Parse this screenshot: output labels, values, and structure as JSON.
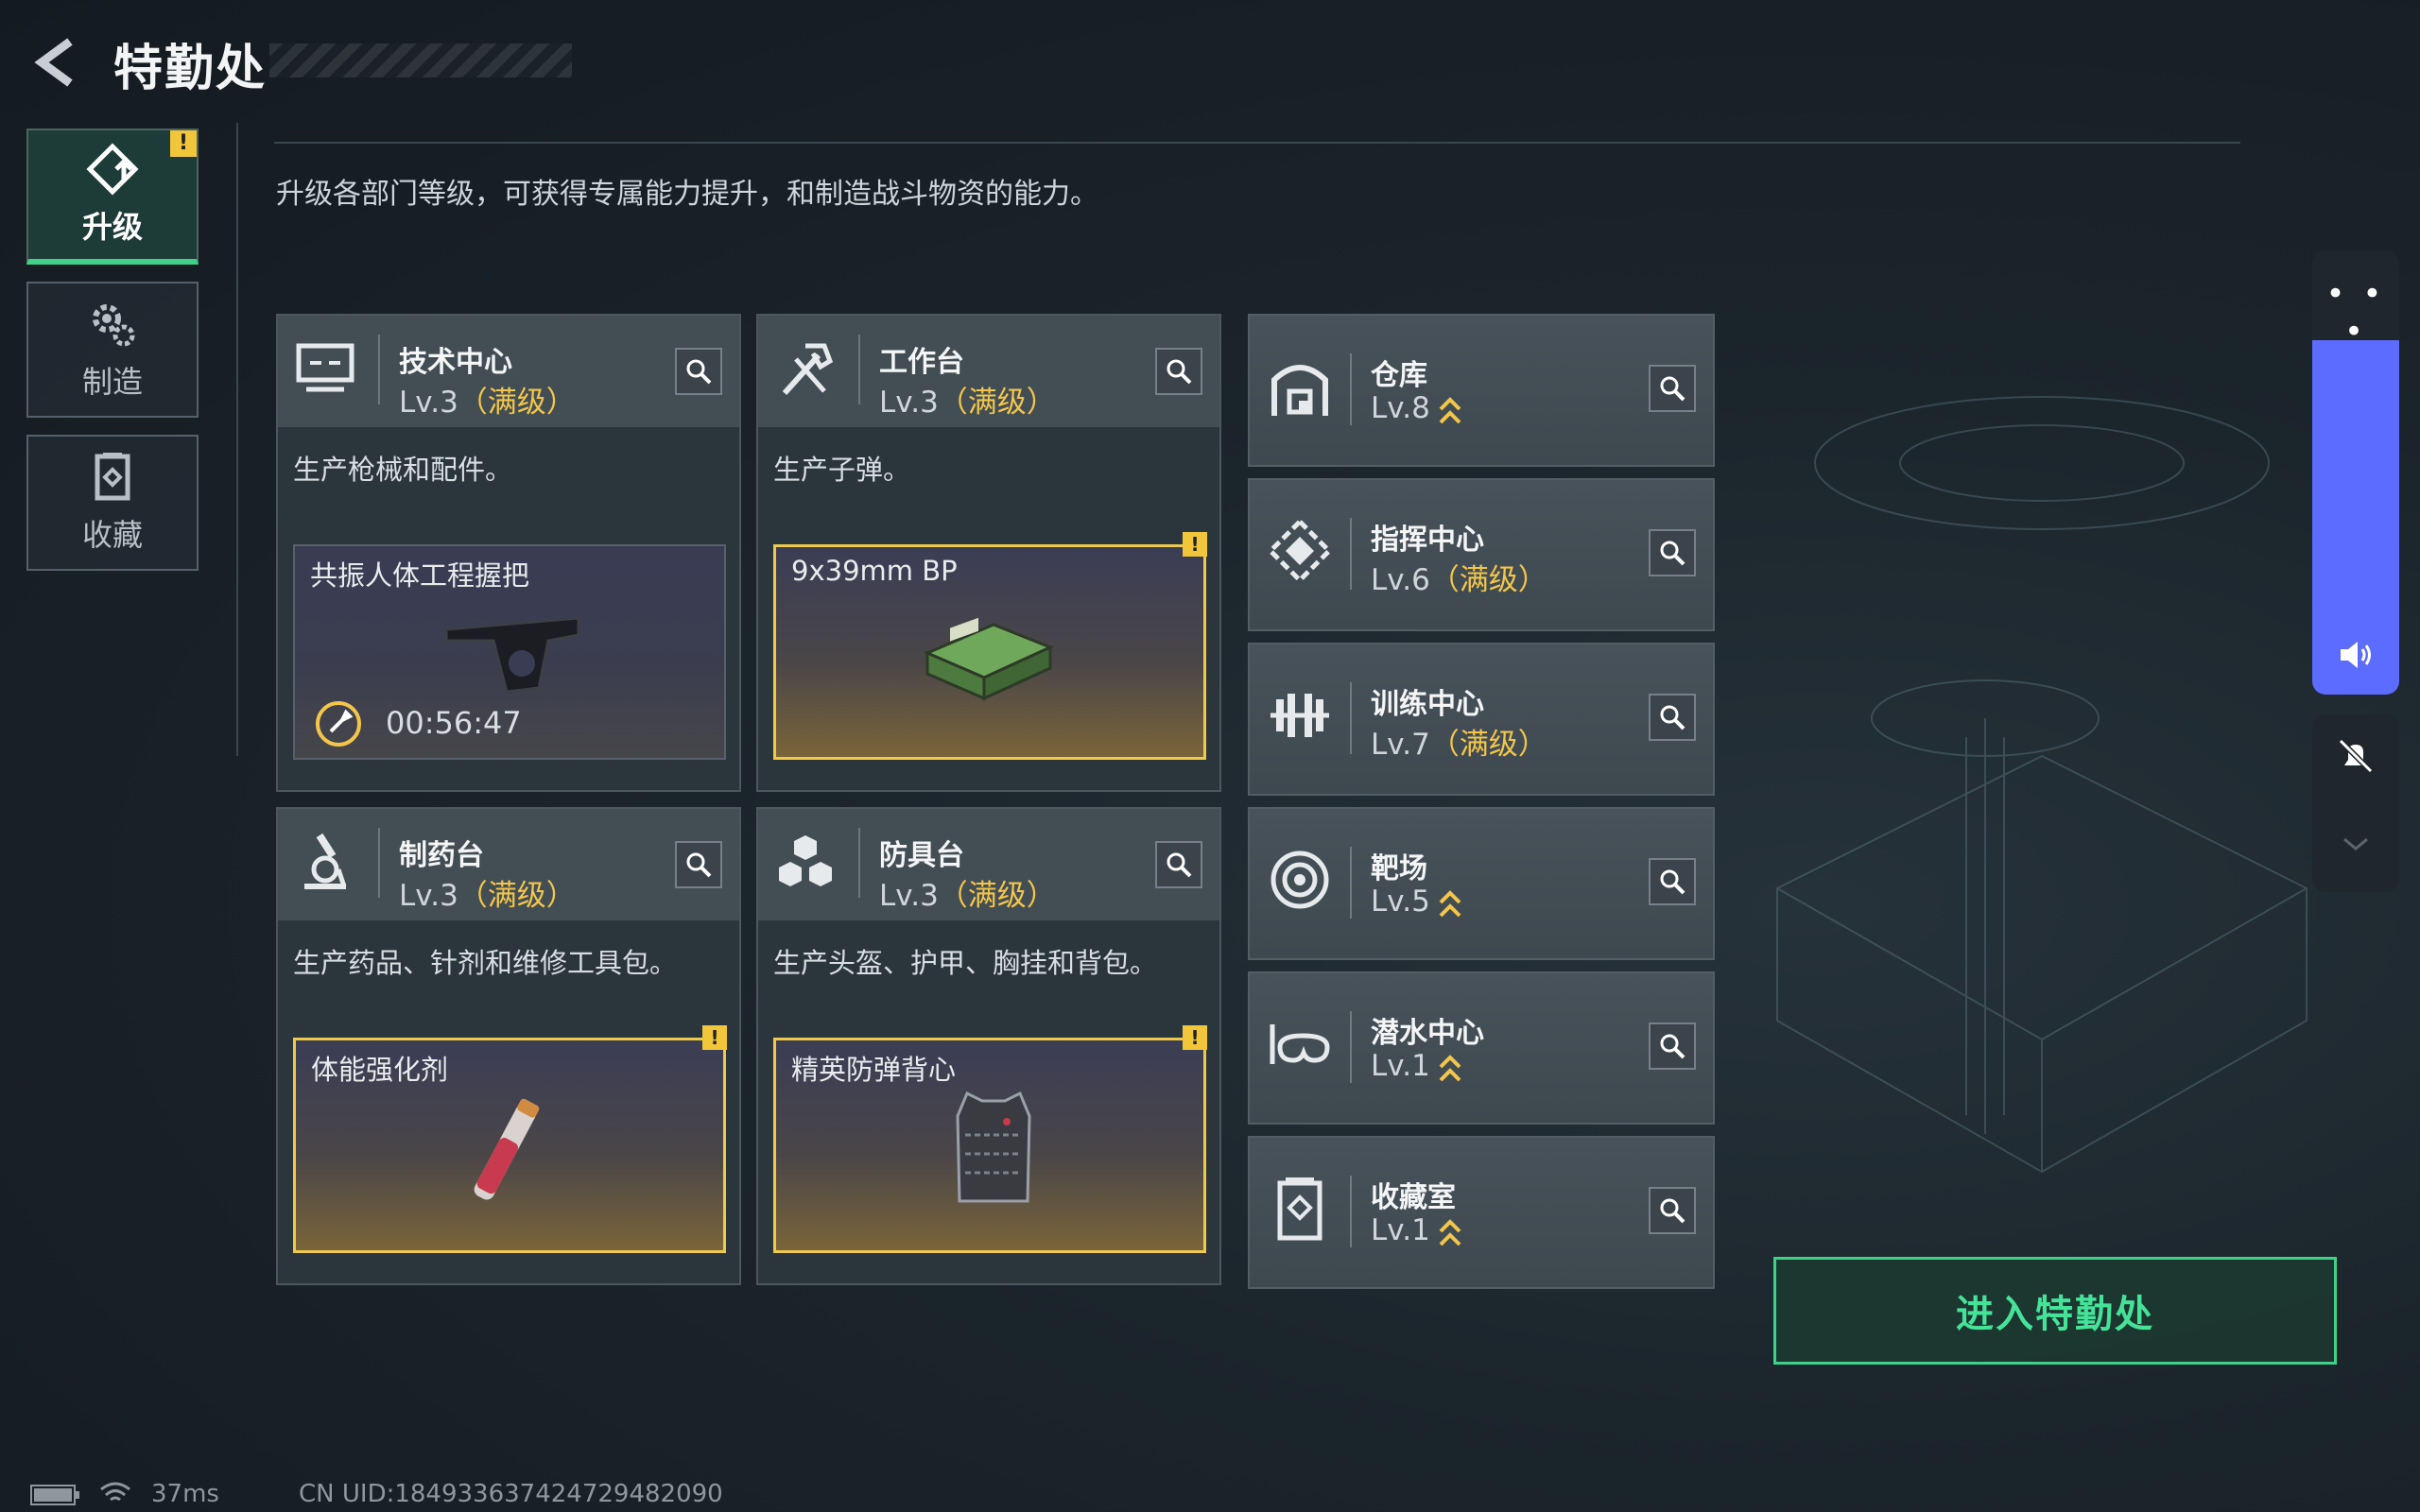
{
  "header": {
    "title": "特勤处",
    "back_icon": "back-arrow-icon"
  },
  "nav": [
    {
      "label": "升级",
      "icon": "upgrade-icon",
      "active": true,
      "alert": "!"
    },
    {
      "label": "制造",
      "icon": "gear-icon",
      "active": false
    },
    {
      "label": "收藏",
      "icon": "collection-icon",
      "active": false
    }
  ],
  "description": "升级各部门等级，可获得专属能力提升，和制造战斗物资的能力。",
  "workshops": [
    {
      "name": "技术中心",
      "level": "Lv.3",
      "max_tag": "（满级）",
      "icon": "computer-icon",
      "desc": "生产枪械和配件。",
      "craft": {
        "name": "共振人体工程握把",
        "timer": "00:56:47",
        "complete": false
      }
    },
    {
      "name": "工作台",
      "level": "Lv.3",
      "max_tag": "（满级）",
      "icon": "hammer-icon",
      "desc": "生产子弹。",
      "craft": {
        "name": "9x39mm BP",
        "complete": true,
        "alert": "!"
      }
    },
    {
      "name": "制药台",
      "level": "Lv.3",
      "max_tag": "（满级）",
      "icon": "microscope-icon",
      "desc": "生产药品、针剂和维修工具包。",
      "craft": {
        "name": "体能强化剂",
        "complete": true,
        "alert": "!"
      }
    },
    {
      "name": "防具台",
      "level": "Lv.3",
      "max_tag": "（满级）",
      "icon": "cubes-icon",
      "desc": "生产头盔、护甲、胸挂和背包。",
      "craft": {
        "name": "精英防弹背心",
        "complete": true,
        "alert": "!"
      }
    }
  ],
  "facilities": [
    {
      "name": "仓库",
      "level": "Lv.8",
      "max_tag": "",
      "upgradable": true,
      "icon": "warehouse-icon"
    },
    {
      "name": "指挥中心",
      "level": "Lv.6",
      "max_tag": "（满级）",
      "upgradable": false,
      "icon": "command-icon"
    },
    {
      "name": "训练中心",
      "level": "Lv.7",
      "max_tag": "（满级）",
      "upgradable": false,
      "icon": "dumbbell-icon"
    },
    {
      "name": "靶场",
      "level": "Lv.5",
      "max_tag": "",
      "upgradable": true,
      "icon": "target-icon"
    },
    {
      "name": "潜水中心",
      "level": "Lv.1",
      "max_tag": "",
      "upgradable": true,
      "icon": "diving-mask-icon"
    },
    {
      "name": "收藏室",
      "level": "Lv.1",
      "max_tag": "",
      "upgradable": true,
      "icon": "collection-room-icon"
    }
  ],
  "enter_button": "进入特勤处",
  "side_control": {
    "dots": "• • •",
    "volume_icon": "speaker-icon",
    "mute_icon": "bell-off-icon"
  },
  "status_bar": {
    "ping": "37ms",
    "uid": "CN UID:184933637424729482090"
  },
  "colors": {
    "accent_green": "#3fd18a",
    "gold": "#f1c64b",
    "volume_blue": "#5c6cff"
  }
}
